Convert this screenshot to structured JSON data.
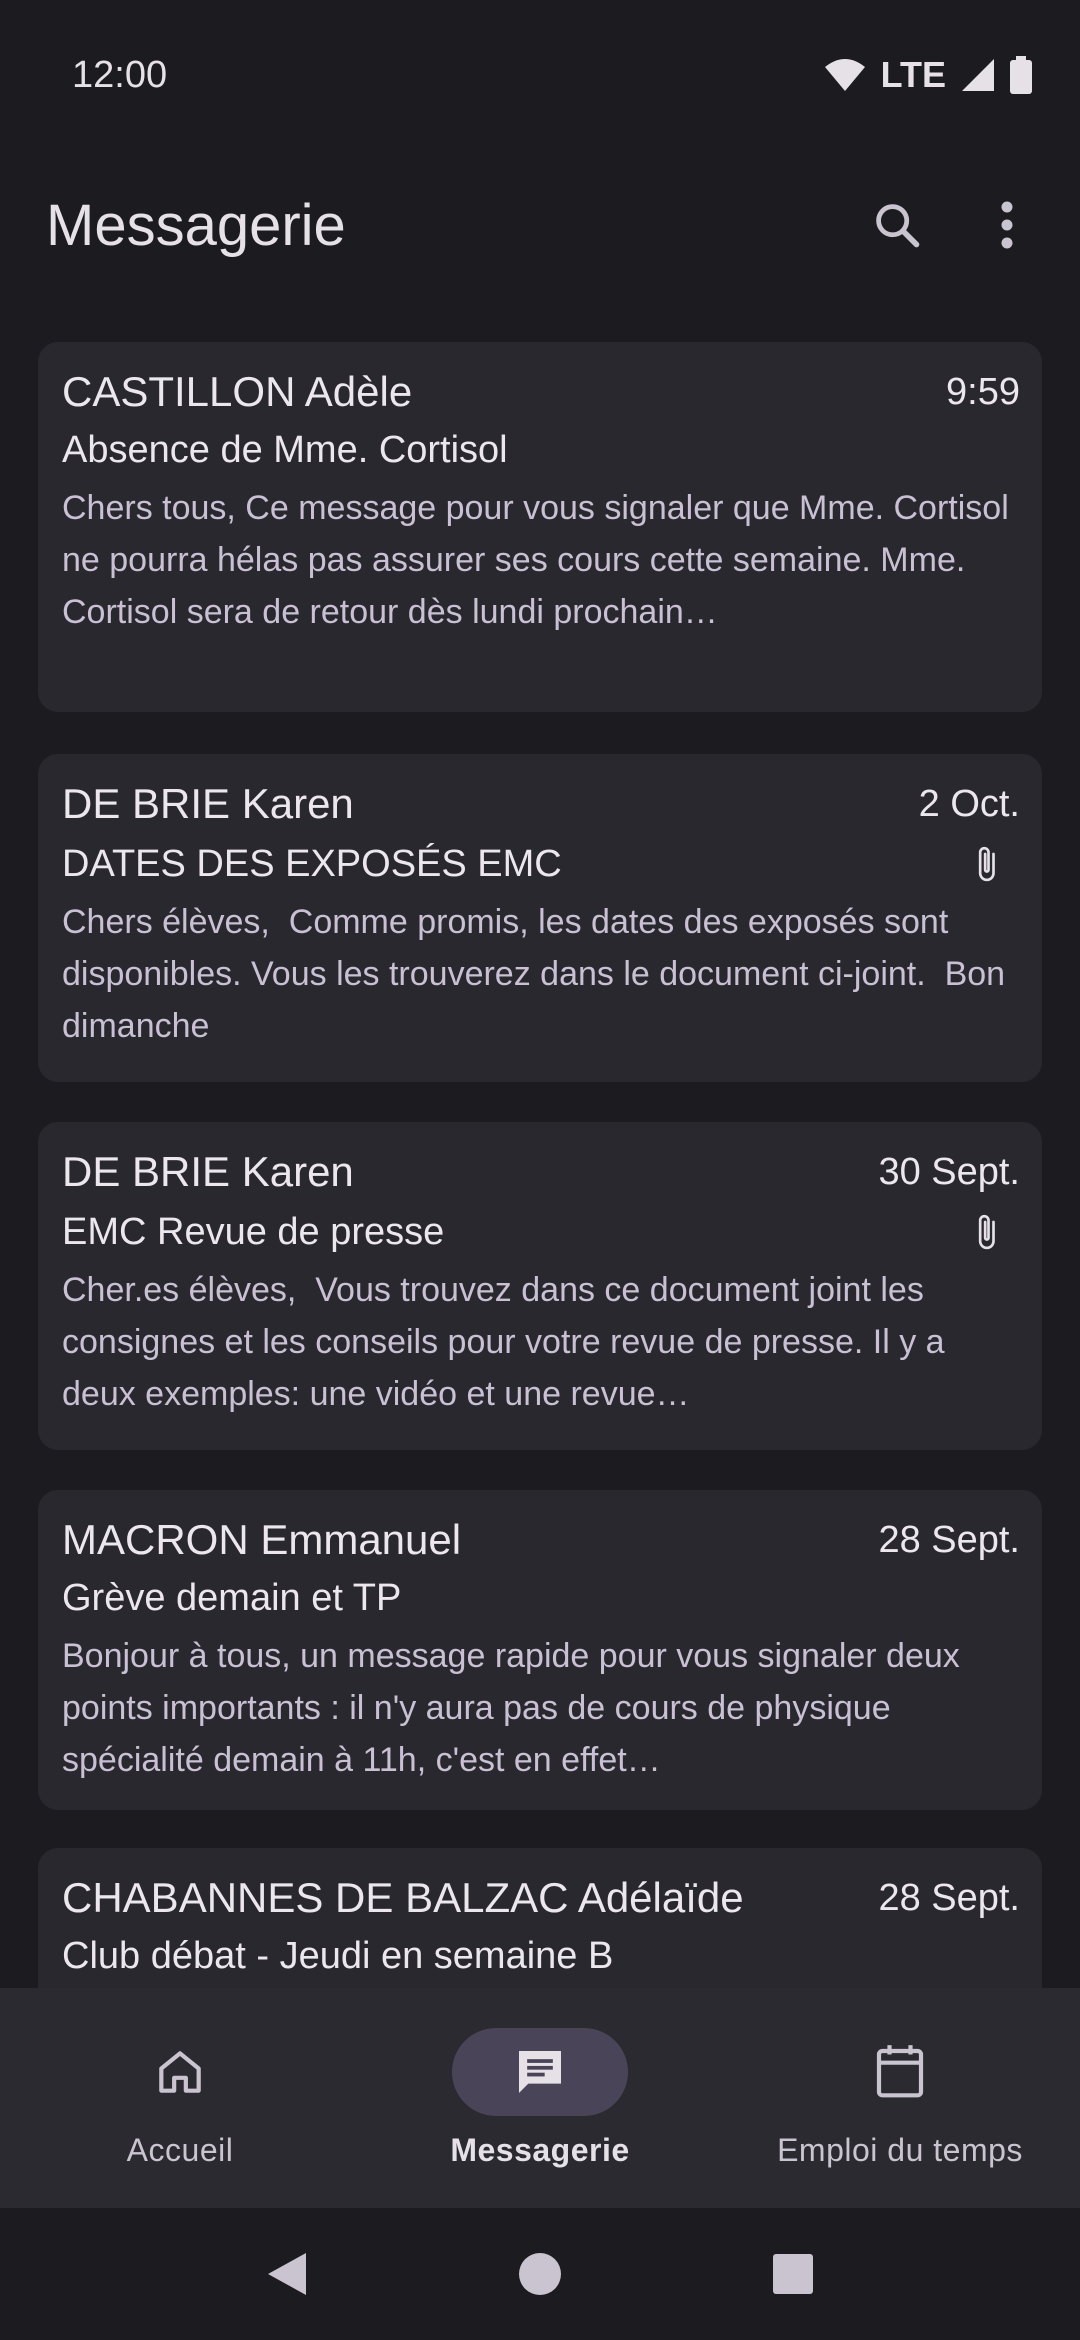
{
  "status": {
    "time": "12:00",
    "network": "LTE"
  },
  "header": {
    "title": "Messagerie"
  },
  "messages": [
    {
      "sender": "CASTILLON Adèle",
      "date": "9:59",
      "subject": "Absence de Mme. Cortisol",
      "preview": "Chers tous, Ce message pour vous signaler que Mme. Cortisol  ne pourra hélas pas assurer ses cours cette semaine. Mme. Cortisol sera de retour dès lundi prochain…",
      "attachment": false
    },
    {
      "sender": "DE BRIE Karen",
      "date": "2 Oct.",
      "subject": "DATES DES EXPOSÉS EMC",
      "preview": "Chers élèves,  Comme promis, les dates des exposés sont disponibles. Vous les trouverez dans le document ci-joint.  Bon dimanche",
      "attachment": true
    },
    {
      "sender": "DE BRIE Karen",
      "date": "30 Sept.",
      "subject": "EMC Revue de presse",
      "preview": "Cher.es élèves,  Vous trouvez dans ce document joint les consignes et les conseils pour votre revue de presse. Il y a deux exemples: une vidéo et une revue…",
      "attachment": true
    },
    {
      "sender": "MACRON Emmanuel",
      "date": "28 Sept.",
      "subject": "Grève demain et TP",
      "preview": "Bonjour à tous, un message rapide pour vous signaler deux points importants : il n'y aura pas de cours de physique spécialité demain à 11h, c'est en effet…",
      "attachment": false
    },
    {
      "sender": "CHABANNES DE BALZAC Adélaïde",
      "date": "28 Sept.",
      "subject": "Club débat - Jeudi en semaine B",
      "preview": "",
      "attachment": false
    }
  ],
  "bottom_nav": {
    "items": [
      {
        "label": "Accueil",
        "icon": "home-icon",
        "active": false
      },
      {
        "label": "Messagerie",
        "icon": "message-icon",
        "active": true
      },
      {
        "label": "Emploi du temps",
        "icon": "calendar-icon",
        "active": false
      }
    ]
  },
  "colors": {
    "background": "#1c1b20",
    "card": "#29282e",
    "nav": "#2b2a30",
    "active_pill": "#4a4458"
  }
}
